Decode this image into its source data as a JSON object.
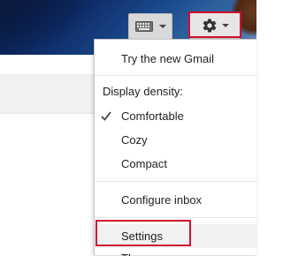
{
  "toolbar": {
    "keyboard_icon": "keyboard-icon",
    "settings_icon": "gear-icon",
    "dropdown_icon": "chevron-down-icon"
  },
  "menu": {
    "try_new": "Try the new Gmail",
    "density_label": "Display density:",
    "density_options": [
      {
        "label": "Comfortable",
        "checked": true
      },
      {
        "label": "Cozy",
        "checked": false
      },
      {
        "label": "Compact",
        "checked": false
      }
    ],
    "configure_inbox": "Configure inbox",
    "settings": "Settings",
    "themes": "Themes"
  },
  "colors": {
    "highlight_border": "#d0102f",
    "menu_text": "#222222",
    "hover_background": "#f1f1f1"
  }
}
